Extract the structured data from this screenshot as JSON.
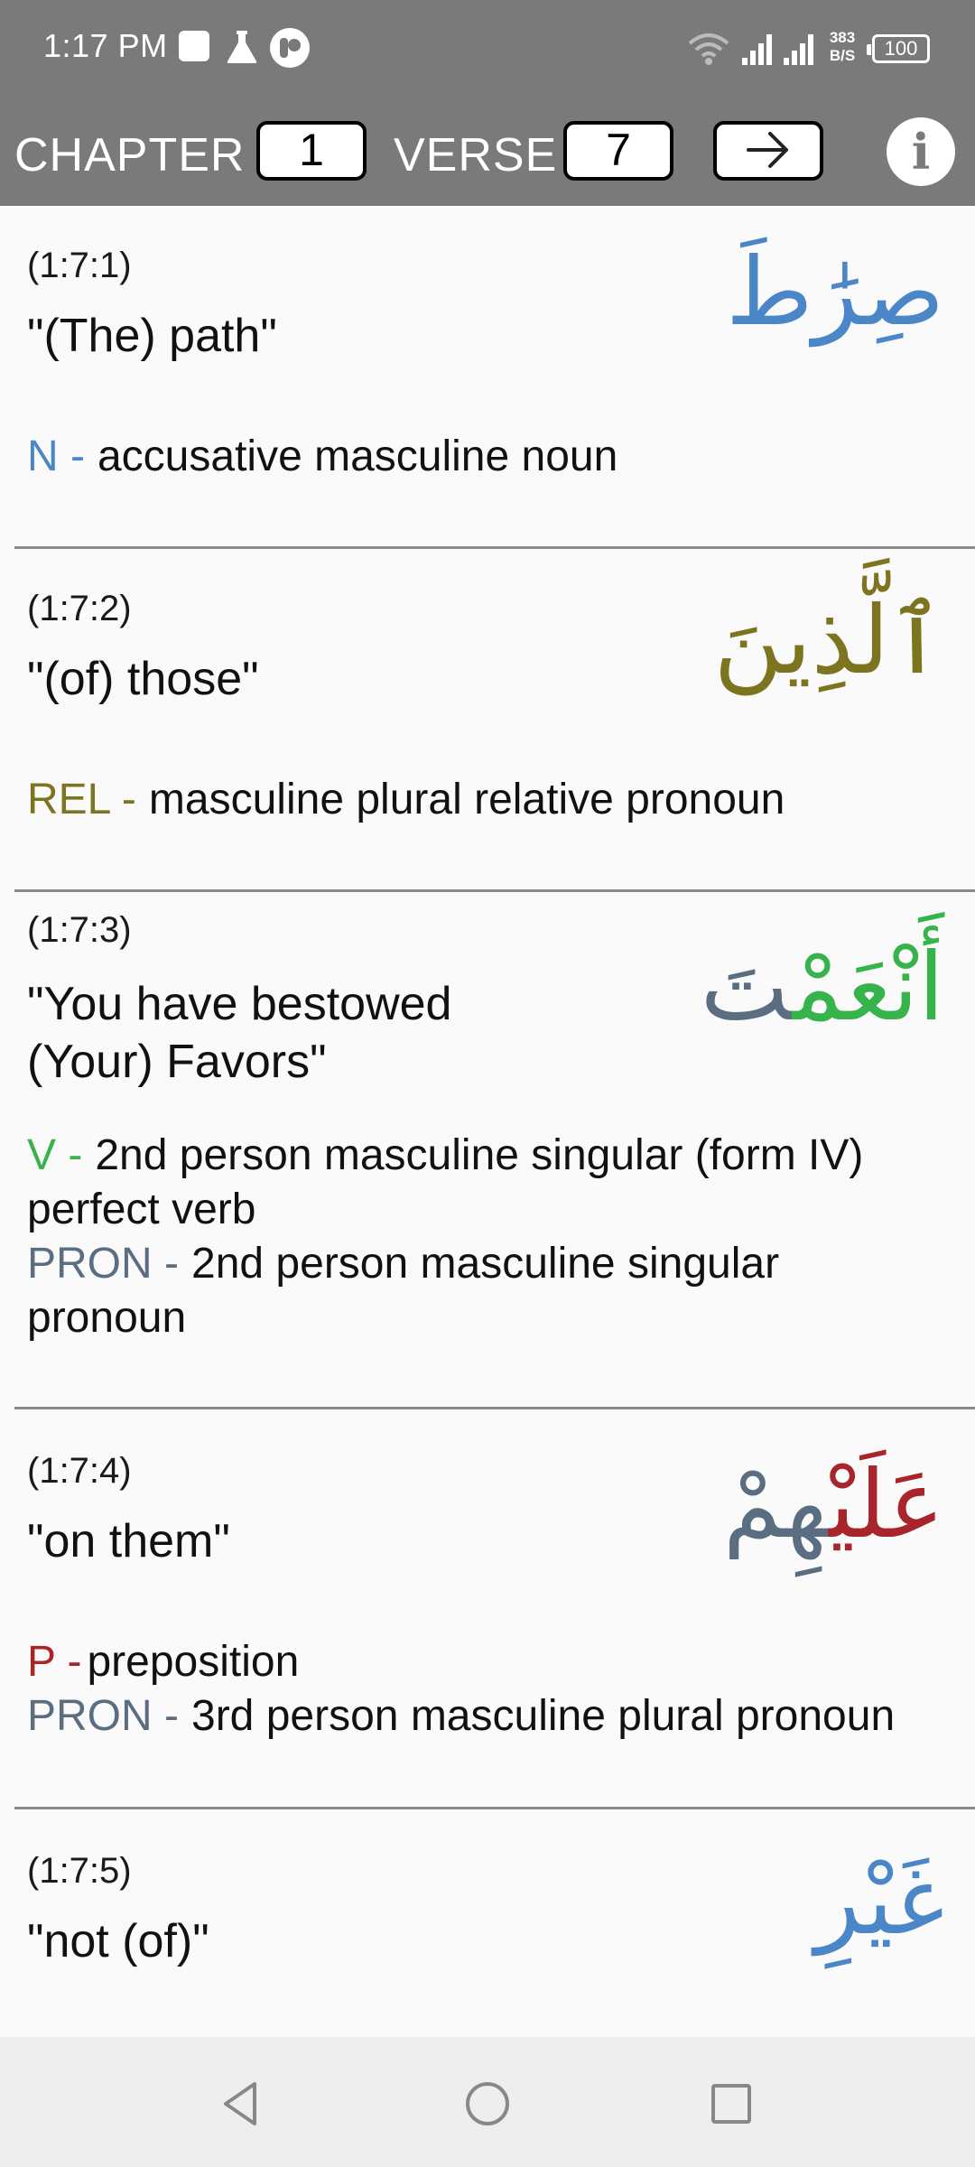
{
  "status_bar": {
    "time": "1:17 PM",
    "net_speed_value": "383",
    "net_speed_unit": "B/S",
    "battery": "100"
  },
  "toolbar": {
    "chapter_label": "CHAPTER",
    "chapter_value": "1",
    "verse_label": "VERSE",
    "verse_value": "7",
    "go_icon": "arrow-right-icon",
    "info_icon": "info-icon",
    "info_glyph": "i"
  },
  "colors": {
    "noun": "#4a86c8",
    "relative": "#7d7420",
    "verb": "#36b34a",
    "pronoun": "#5b6d80",
    "preposition": "#a8252b",
    "header_bg": "#7a7a7a"
  },
  "entries": [
    {
      "ref": "(1:7:1)",
      "gloss": "\"(The) path\"",
      "arabic": "صِرَٰطَ",
      "morph": [
        {
          "tag": "N -",
          "text": "accusative masculine noun"
        }
      ]
    },
    {
      "ref": "(1:7:2)",
      "gloss": "\"(of) those\"",
      "arabic": "ٱلَّذِينَ",
      "morph": [
        {
          "tag": "REL -",
          "text": "masculine plural relative pronoun"
        }
      ]
    },
    {
      "ref": "(1:7:3)",
      "gloss_line1": "\"You have bestowed",
      "gloss_line2": "(Your) Favors\"",
      "arabic_part1": "أَنْعَمْ",
      "arabic_part2": "تَ",
      "morph": [
        {
          "tag": "V -",
          "text": "2nd person masculine singular (form IV) perfect verb"
        },
        {
          "tag": "PRON -",
          "text": "2nd person masculine singular pronoun"
        }
      ]
    },
    {
      "ref": "(1:7:4)",
      "gloss": "\"on them\"",
      "arabic_part1": "عَلَيْ",
      "arabic_part2": "هِمْ",
      "morph": [
        {
          "tag": "P -",
          "text": "preposition"
        },
        {
          "tag": "PRON -",
          "text": "3rd person masculine plural pronoun"
        }
      ]
    },
    {
      "ref": "(1:7:5)",
      "gloss": "\"not (of)\"",
      "arabic": "غَيْرِ"
    }
  ],
  "nav_bar": {
    "back_icon": "back-triangle-icon",
    "home_icon": "home-circle-icon",
    "recents_icon": "recents-square-icon"
  }
}
